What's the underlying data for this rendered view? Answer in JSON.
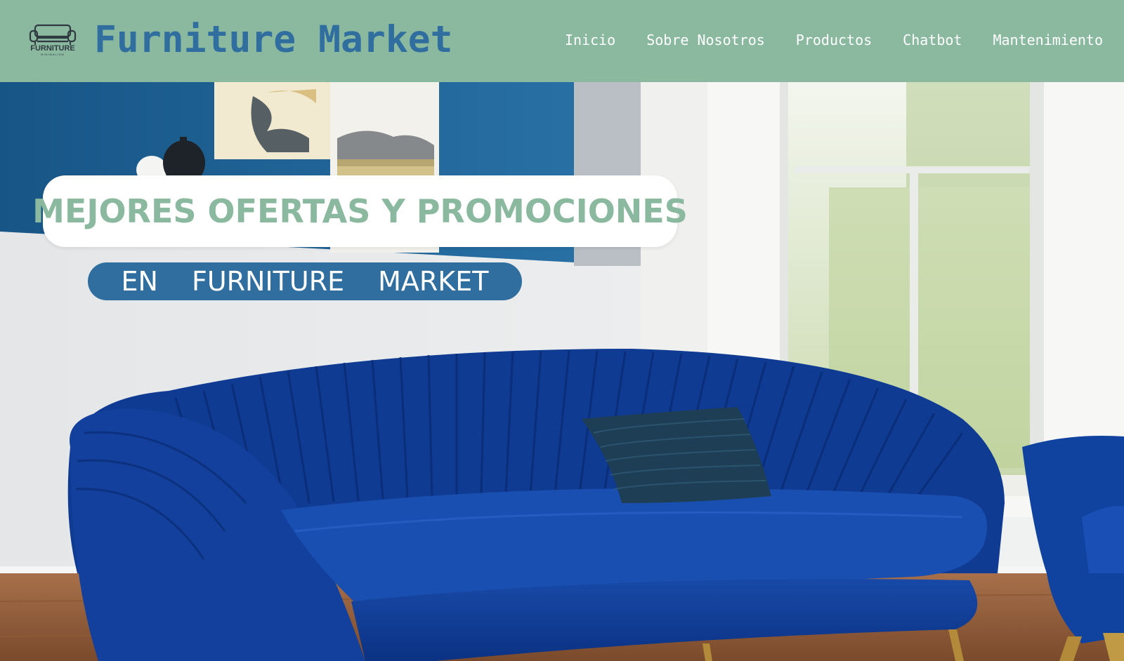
{
  "header": {
    "logo": {
      "wordmark": "FURNITURE",
      "tagline": "MINIMALISM"
    },
    "brand": "Furniture Market",
    "nav": [
      {
        "label": "Inicio"
      },
      {
        "label": "Sobre Nosotros"
      },
      {
        "label": "Productos"
      },
      {
        "label": "Chatbot"
      },
      {
        "label": "Mantenimiento"
      }
    ]
  },
  "hero": {
    "promo_title": "MEJORES OFERTAS Y PROMOCIONES",
    "promo_subtitle_words": [
      "EN",
      "FURNITURE",
      "MARKET"
    ],
    "image_subject": "blue channel-tufted velvet sofa in living room"
  },
  "colors": {
    "header_bg": "#8bb9a0",
    "brand_blue": "#2f6e9e",
    "sofa_blue": "#0d3c8f",
    "wall_blue": "#1f5f93"
  }
}
